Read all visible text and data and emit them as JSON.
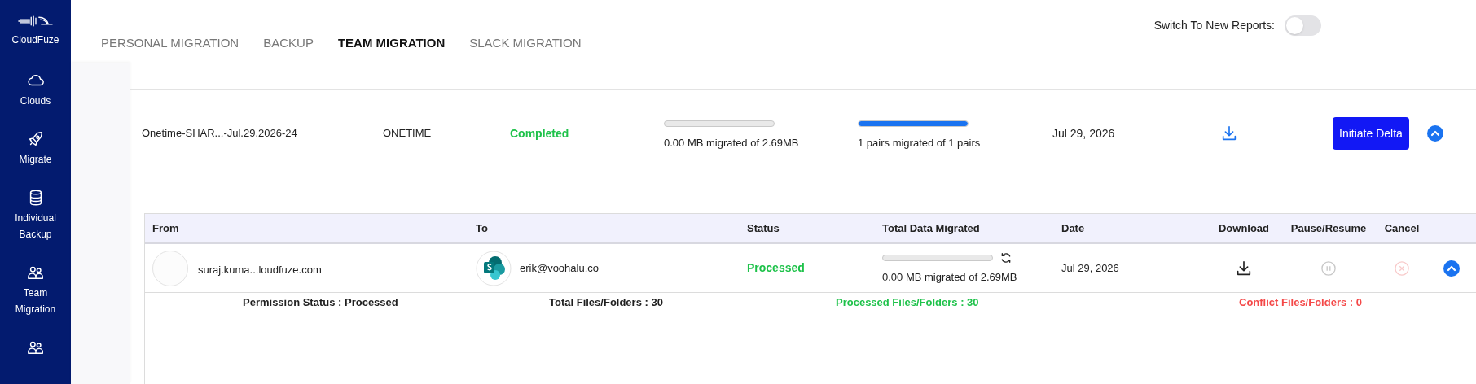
{
  "sidebar": {
    "brand": "CloudFuze",
    "items": [
      {
        "label": "Clouds",
        "kind": "cloud"
      },
      {
        "label": "Migrate",
        "kind": "rocket"
      },
      {
        "label": "Individual Backup",
        "kind": "database"
      },
      {
        "label": "Team Migration",
        "kind": "users"
      },
      {
        "kind": "users"
      }
    ]
  },
  "tabs": [
    {
      "label": "PERSONAL MIGRATION",
      "selected": false
    },
    {
      "label": "BACKUP",
      "selected": false
    },
    {
      "label": "TEAM MIGRATION",
      "selected": true
    },
    {
      "label": "SLACK MIGRATION",
      "selected": false
    }
  ],
  "reports_toggle": {
    "label": "Switch To New Reports:",
    "on": false
  },
  "job": {
    "name": "Onetime-SHAR...-Jul.29.2026-24",
    "type": "ONETIME",
    "status": "Completed",
    "data": {
      "level": 0,
      "text": "0.00 MB migrated of 2.69MB"
    },
    "pairs": {
      "level": 1,
      "text": "1 pairs migrated of 1 pairs"
    },
    "date": "Jul 29, 2026",
    "button": "Initiate Delta",
    "expanded": true
  },
  "table": {
    "columns": [
      "From",
      "To",
      "Status",
      "Total Data Migrated",
      "Date",
      "Download",
      "Pause/Resume",
      "Cancel"
    ],
    "rows": [
      {
        "from": "suraj.kuma...loudfuze.com",
        "to": "erik@voohalu.co",
        "status": "Processed",
        "data": {
          "level": 0,
          "text": "0.00 MB migrated of 2.69MB"
        },
        "date": "Jul 29, 2026",
        "expanded": true,
        "details": [
          {
            "text": "Permission Status : Processed",
            "color": "#1f1f1f"
          },
          {
            "text": "Total Files/Folders : 30",
            "color": "#1f1f1f"
          },
          {
            "text": "Processed Files/Folders : 30",
            "color": "#1ec24a"
          },
          {
            "text": "Conflict Files/Folders : 0",
            "color": "#f44848"
          }
        ]
      }
    ]
  }
}
